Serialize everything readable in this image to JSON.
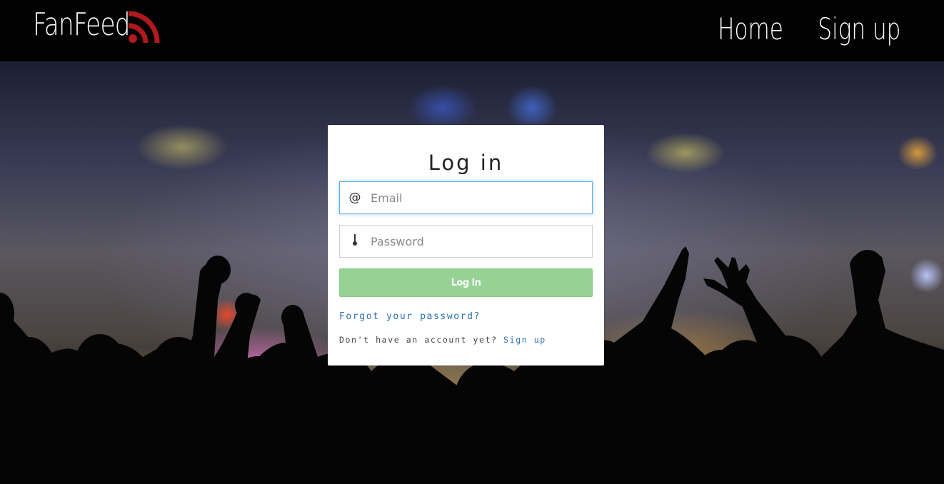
{
  "navbar": {
    "brand": "FanFeed",
    "brand_icon": "rss-icon",
    "links": [
      {
        "label": "Home"
      },
      {
        "label": "Sign up"
      }
    ]
  },
  "login_card": {
    "title": "Log in",
    "email": {
      "icon": "at-sign-icon",
      "placeholder": "Email",
      "value": ""
    },
    "password": {
      "icon": "key-icon",
      "placeholder": "Password",
      "value": ""
    },
    "submit_label": "Log in",
    "forgot_link": "Forgot your password?",
    "no_account_text": "Don't have an account yet?",
    "signup_link": "Sign up"
  },
  "colors": {
    "navbar_bg": "#020202",
    "brand_icon_red": "#b0191e",
    "login_button_green": "#96d294",
    "link_blue": "#2a6fb0",
    "focus_border": "#66afe9"
  }
}
